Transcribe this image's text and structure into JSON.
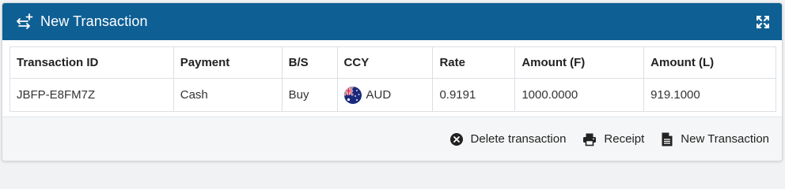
{
  "panel": {
    "title": "New Transaction",
    "header_icon": "transaction-add-icon",
    "expand_icon": "expand-icon"
  },
  "table": {
    "columns": [
      "Transaction ID",
      "Payment",
      "B/S",
      "CCY",
      "Rate",
      "Amount (F)",
      "Amount (L)"
    ],
    "rows": [
      {
        "transaction_id": "JBFP-E8FM7Z",
        "payment": "Cash",
        "bs": "Buy",
        "ccy": "AUD",
        "ccy_flag": "australia-flag-icon",
        "rate": "0.9191",
        "amount_f": "1000.0000",
        "amount_l": "919.1000"
      }
    ]
  },
  "footer": {
    "actions": [
      {
        "label": "Delete transaction",
        "icon": "close-circle-icon"
      },
      {
        "label": "Receipt",
        "icon": "printer-icon"
      },
      {
        "label": "New Transaction",
        "icon": "document-icon"
      }
    ]
  },
  "colors": {
    "header_bg": "#0e5f94",
    "header_text": "#ffffff",
    "border": "#dcdfe3",
    "footer_bg": "#f5f6f7"
  }
}
